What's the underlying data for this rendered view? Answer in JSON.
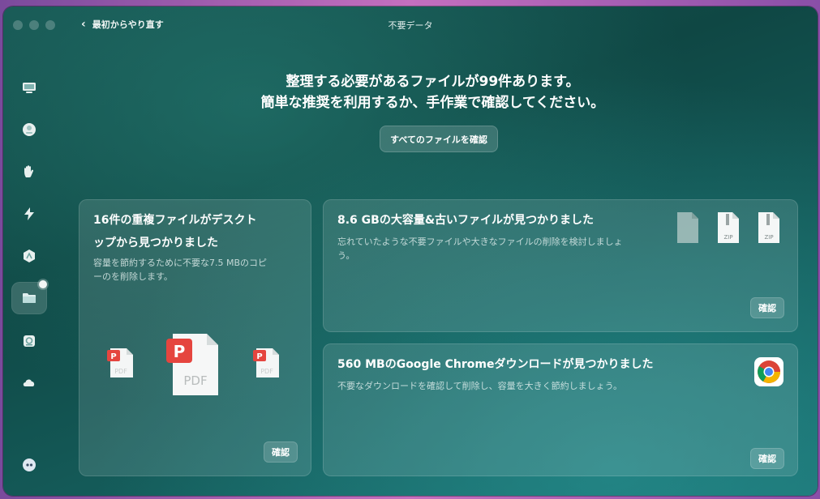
{
  "window": {
    "title": "不要データ",
    "back_label": "最初からやり直す"
  },
  "sidebar": {
    "items": [
      {
        "icon": "monitor-icon"
      },
      {
        "icon": "disk-icon"
      },
      {
        "icon": "hand-icon"
      },
      {
        "icon": "lightning-icon"
      },
      {
        "icon": "apps-icon"
      },
      {
        "icon": "folder-icon",
        "active": true
      },
      {
        "icon": "scanner-icon"
      },
      {
        "icon": "cloud-icon"
      }
    ],
    "footer_icon": "assistant-icon"
  },
  "headline": {
    "line1": "整理する必要があるファイルが99件あります。",
    "line2": "簡単な推奨を利用するか、手作業で確認してください。"
  },
  "review_all_label": "すべてのファイルを確認",
  "cards": {
    "duplicates": {
      "title_line1": "16件の重複ファイルがデスクト",
      "title_line2": "ップから見つかりました",
      "desc_line1": "容量を節約するために不要な7.5 MBのコピ",
      "desc_line2": "ーのを削除します。",
      "button": "確認",
      "icon_label": "PDF"
    },
    "large_old": {
      "title": "8.6 GBの大容量&古いファイルが見つかりました",
      "desc_line1": "忘れていたような不要ファイルや大きなファイルの削除を検討しましょ",
      "desc_line2": "う。",
      "button": "確認",
      "icon_label": "ZIP"
    },
    "chrome": {
      "title": "560 MBのGoogle Chromeダウンロードが見つかりました",
      "desc": "不要なダウンロードを確認して削除し、容量を大きく節約しましょう。",
      "button": "確認"
    }
  },
  "colors": {
    "pdf_red": "#e5453f",
    "window_bg": "#125250"
  }
}
